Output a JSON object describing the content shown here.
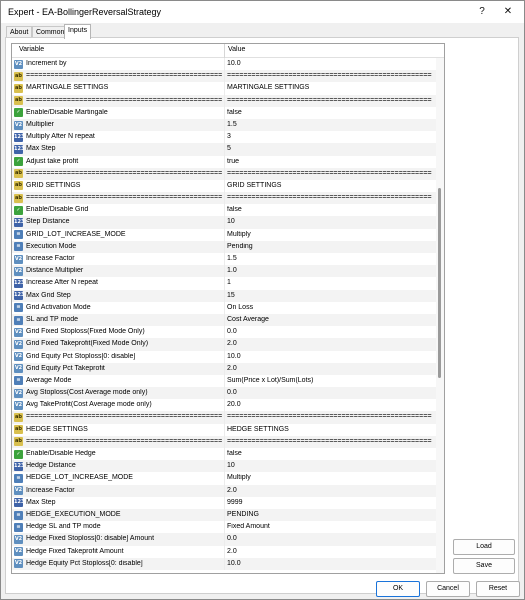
{
  "window": {
    "title": "Expert - EA-BollingerReversalStrategy"
  },
  "titlebar": {
    "help": "?",
    "close": "✕"
  },
  "tabs": [
    {
      "label": "About"
    },
    {
      "label": "Common"
    },
    {
      "label": "Inputs"
    }
  ],
  "table": {
    "col_variable": "Variable",
    "col_value": "Value",
    "rows": [
      {
        "type": "dbl",
        "icon": "V2",
        "name": "Increment by",
        "value": "10.0"
      },
      {
        "type": "str",
        "icon": "ab",
        "name": "====================================================",
        "value": "===================================================="
      },
      {
        "type": "str",
        "icon": "ab",
        "name": "MARTINGALE SETTINGS",
        "value": "MARTINGALE SETTINGS"
      },
      {
        "type": "str",
        "icon": "ab",
        "name": "====================================================",
        "value": "===================================================="
      },
      {
        "type": "bool",
        "icon": "✓",
        "name": "Enable/Disable Martingale",
        "value": "false"
      },
      {
        "type": "dbl",
        "icon": "V2",
        "name": "Multiplier",
        "value": "1.5"
      },
      {
        "type": "int",
        "icon": "123",
        "name": "Multiply After N repeat",
        "value": "3"
      },
      {
        "type": "int",
        "icon": "123",
        "name": "Max Step",
        "value": "5"
      },
      {
        "type": "bool",
        "icon": "✓",
        "name": "Adjust take profit",
        "value": "true"
      },
      {
        "type": "str",
        "icon": "ab",
        "name": "====================================================",
        "value": "===================================================="
      },
      {
        "type": "str",
        "icon": "ab",
        "name": "GRID SETTINGS",
        "value": "GRID SETTINGS"
      },
      {
        "type": "str",
        "icon": "ab",
        "name": "====================================================",
        "value": "===================================================="
      },
      {
        "type": "bool",
        "icon": "✓",
        "name": "Enable/Disable Grid",
        "value": "false"
      },
      {
        "type": "int",
        "icon": "123",
        "name": "Step Distance",
        "value": "10"
      },
      {
        "type": "enum",
        "icon": "≡",
        "name": "GRID_LOT_INCREASE_MODE",
        "value": "Multiply"
      },
      {
        "type": "enum",
        "icon": "≡",
        "name": "Execution Mode",
        "value": "Pending"
      },
      {
        "type": "dbl",
        "icon": "V2",
        "name": "Increase Factor",
        "value": "1.5"
      },
      {
        "type": "dbl",
        "icon": "V2",
        "name": "Distance Multiplier",
        "value": "1.0"
      },
      {
        "type": "int",
        "icon": "123",
        "name": "Increase After N repeat",
        "value": "1"
      },
      {
        "type": "int",
        "icon": "123",
        "name": "Max Grid Step",
        "value": "15"
      },
      {
        "type": "enum",
        "icon": "≡",
        "name": "Grid Activation Mode",
        "value": "On Loss"
      },
      {
        "type": "enum",
        "icon": "≡",
        "name": "SL and TP mode",
        "value": "Cost Average"
      },
      {
        "type": "dbl",
        "icon": "V2",
        "name": "Grid Fixed Stoploss(Fixed Mode Only)",
        "value": "0.0"
      },
      {
        "type": "dbl",
        "icon": "V2",
        "name": "Grid Fixed Takeprofit(Fixed Mode Only)",
        "value": "2.0"
      },
      {
        "type": "dbl",
        "icon": "V2",
        "name": "Grid Equity Pct Stoploss[0: disable]",
        "value": "10.0"
      },
      {
        "type": "dbl",
        "icon": "V2",
        "name": "Grid Equity Pct Takeprofit",
        "value": "2.0"
      },
      {
        "type": "enum",
        "icon": "≡",
        "name": "Average Mode",
        "value": "Sum(Price x Lot)/Sum(Lots)"
      },
      {
        "type": "dbl",
        "icon": "V2",
        "name": "Avg Stoploss(Cost Average mode only)",
        "value": "0.0"
      },
      {
        "type": "dbl",
        "icon": "V2",
        "name": "Avg TakeProfit(Cost Average mode only)",
        "value": "20.0"
      },
      {
        "type": "str",
        "icon": "ab",
        "name": "====================================================",
        "value": "===================================================="
      },
      {
        "type": "str",
        "icon": "ab",
        "name": "HEDGE SETTINGS",
        "value": "HEDGE SETTINGS"
      },
      {
        "type": "str",
        "icon": "ab",
        "name": "====================================================",
        "value": "===================================================="
      },
      {
        "type": "bool",
        "icon": "✓",
        "name": "Enable/Disable Hedge",
        "value": "false"
      },
      {
        "type": "int",
        "icon": "123",
        "name": "Hedge Distance",
        "value": "10"
      },
      {
        "type": "enum",
        "icon": "≡",
        "name": "HEDGE_LOT_INCREASE_MODE",
        "value": "Multiply"
      },
      {
        "type": "dbl",
        "icon": "V2",
        "name": "Increase Factor",
        "value": "2.0"
      },
      {
        "type": "int",
        "icon": "123",
        "name": "Max Step",
        "value": "9999"
      },
      {
        "type": "enum",
        "icon": "≡",
        "name": "HEDGE_EXECUTION_MODE",
        "value": "PENDING"
      },
      {
        "type": "enum",
        "icon": "≡",
        "name": "Hedge SL and TP mode",
        "value": "Fixed Amount"
      },
      {
        "type": "dbl",
        "icon": "V2",
        "name": "Hedge Fixed Stoploss[0: disable] Amount",
        "value": "0.0"
      },
      {
        "type": "dbl",
        "icon": "V2",
        "name": "Hedge Fixed Takeprofit Amount",
        "value": "2.0"
      },
      {
        "type": "dbl",
        "icon": "V2",
        "name": "Hedge Equity Pct Stoploss[0: disable]",
        "value": "10.0"
      }
    ]
  },
  "buttons": {
    "load": "Load",
    "save": "Save",
    "ok": "OK",
    "cancel": "Cancel",
    "reset": "Reset"
  }
}
